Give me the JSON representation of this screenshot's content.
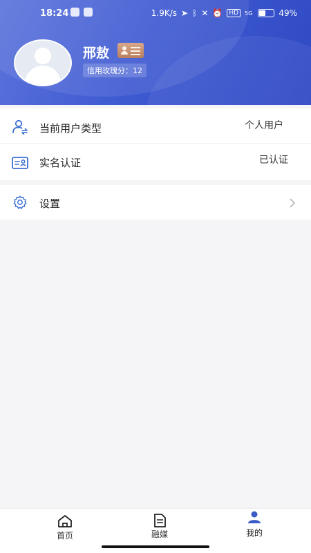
{
  "status_bar": {
    "time": "18:24",
    "network_speed": "1.9K/s",
    "hd_label": "HD",
    "signal_label": "5G",
    "battery_percent": "49%",
    "battery_level": 0.49
  },
  "profile": {
    "name": "邢敖",
    "credit_score_label": "信用玫瑰分：12"
  },
  "menu": {
    "user_type_label": "当前用户类型",
    "user_type_value": "个人用户",
    "realname_label": "实名认证",
    "realname_value": "已认证",
    "settings_label": "设置"
  },
  "tabbar": {
    "home": "首页",
    "media": "融媒",
    "mine": "我的",
    "active_color": "#3b5bc4"
  },
  "colors": {
    "icon_blue": "#3b6fd1",
    "header_start": "#5d74dc",
    "header_end": "#2f49c4"
  }
}
